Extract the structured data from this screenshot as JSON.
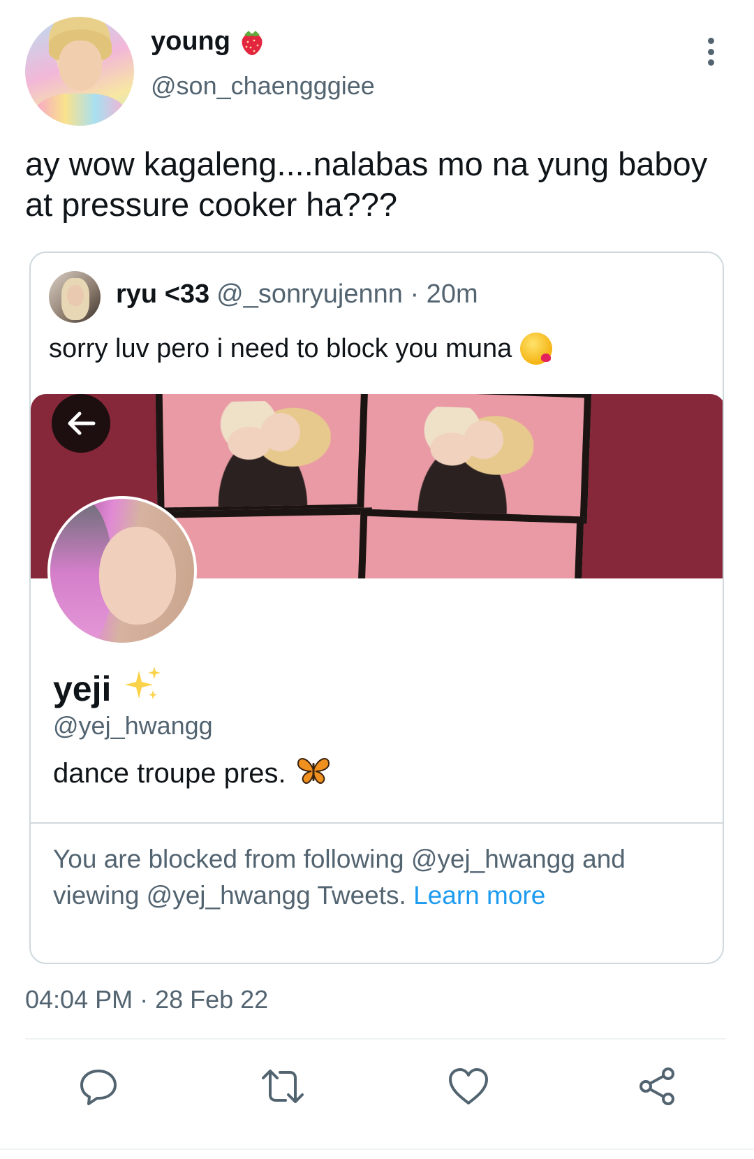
{
  "tweet": {
    "author_name": "young",
    "author_handle": "@son_chaengggiee",
    "text": "ay wow kagaleng....nalabas mo na yung baboy at pressure cooker ha???",
    "timestamp": "04:04 PM · 28 Feb 22"
  },
  "quoted": {
    "name": "ryu <33",
    "handle": "@_sonryujennn",
    "time": "· 20m",
    "text": "sorry luv pero i need to block you muna",
    "profile": {
      "name": "yeji",
      "handle": "@yej_hwangg",
      "bio": "dance troupe pres."
    },
    "blocked_notice": "You are blocked from following @yej_hwangg and viewing @yej_hwangg Tweets.",
    "learn_more": "Learn more"
  },
  "icons": {
    "author_emoji": "strawberry-icon",
    "quote_emoji": "face-blowing-kiss-icon",
    "name_emoji": "sparkles-icon",
    "bio_emoji": "butterfly-icon",
    "actions": [
      "reply-icon",
      "retweet-icon",
      "like-icon",
      "share-icon"
    ]
  },
  "colors": {
    "text_primary": "#0f1419",
    "text_secondary": "#536471",
    "link": "#1d9bf0",
    "border": "#cfd9de"
  }
}
